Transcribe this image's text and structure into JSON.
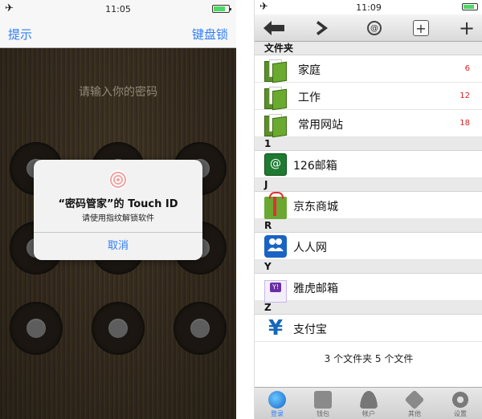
{
  "left_screen": {
    "status_time": "11:05",
    "nav": {
      "left_label": "提示",
      "right_label": "键盘锁"
    },
    "prompt": "请输入你的密码",
    "alert": {
      "title": "“密码管家”的 Touch ID",
      "subtitle": "请使用指纹解锁软件",
      "cancel_label": "取消"
    }
  },
  "right_screen": {
    "status_time": "11:09",
    "toolbar": {
      "back_icon": "arrow-left-icon",
      "forward_icon": "chevron-right-icon",
      "search_icon": "at-search-icon",
      "add_box_icon": "plus-box-icon",
      "add_icon": "plus-icon"
    },
    "sections": [
      {
        "header": "文件夹",
        "rows": [
          {
            "label": "家庭",
            "count": "6",
            "icon": "folder-icon"
          },
          {
            "label": "工作",
            "count": "12",
            "icon": "folder-icon"
          },
          {
            "label": "常用网站",
            "count": "18",
            "icon": "folder-icon"
          }
        ]
      },
      {
        "header": "1",
        "rows": [
          {
            "label": "126邮箱",
            "icon": "mail-126-icon",
            "glyph": "@"
          }
        ]
      },
      {
        "header": "J",
        "rows": [
          {
            "label": "京东商城",
            "icon": "gift-icon"
          }
        ]
      },
      {
        "header": "R",
        "rows": [
          {
            "label": "人人网",
            "icon": "renren-icon"
          }
        ]
      },
      {
        "header": "Y",
        "rows": [
          {
            "label": "雅虎邮箱",
            "icon": "yahoo-mail-icon",
            "glyph": "Y!"
          }
        ]
      },
      {
        "header": "Z",
        "rows": [
          {
            "label": "支付宝",
            "icon": "alipay-icon",
            "glyph": "¥"
          }
        ]
      }
    ],
    "summary": "3 个文件夹   5 个文件",
    "tabs": [
      {
        "label": "登录",
        "icon": "globe-icon",
        "active": true
      },
      {
        "label": "钱包",
        "icon": "wallet-icon",
        "active": false
      },
      {
        "label": "帐户",
        "icon": "user-icon",
        "active": false
      },
      {
        "label": "其他",
        "icon": "box-icon",
        "active": false
      },
      {
        "label": "设置",
        "icon": "gear-icon",
        "active": false
      }
    ]
  }
}
